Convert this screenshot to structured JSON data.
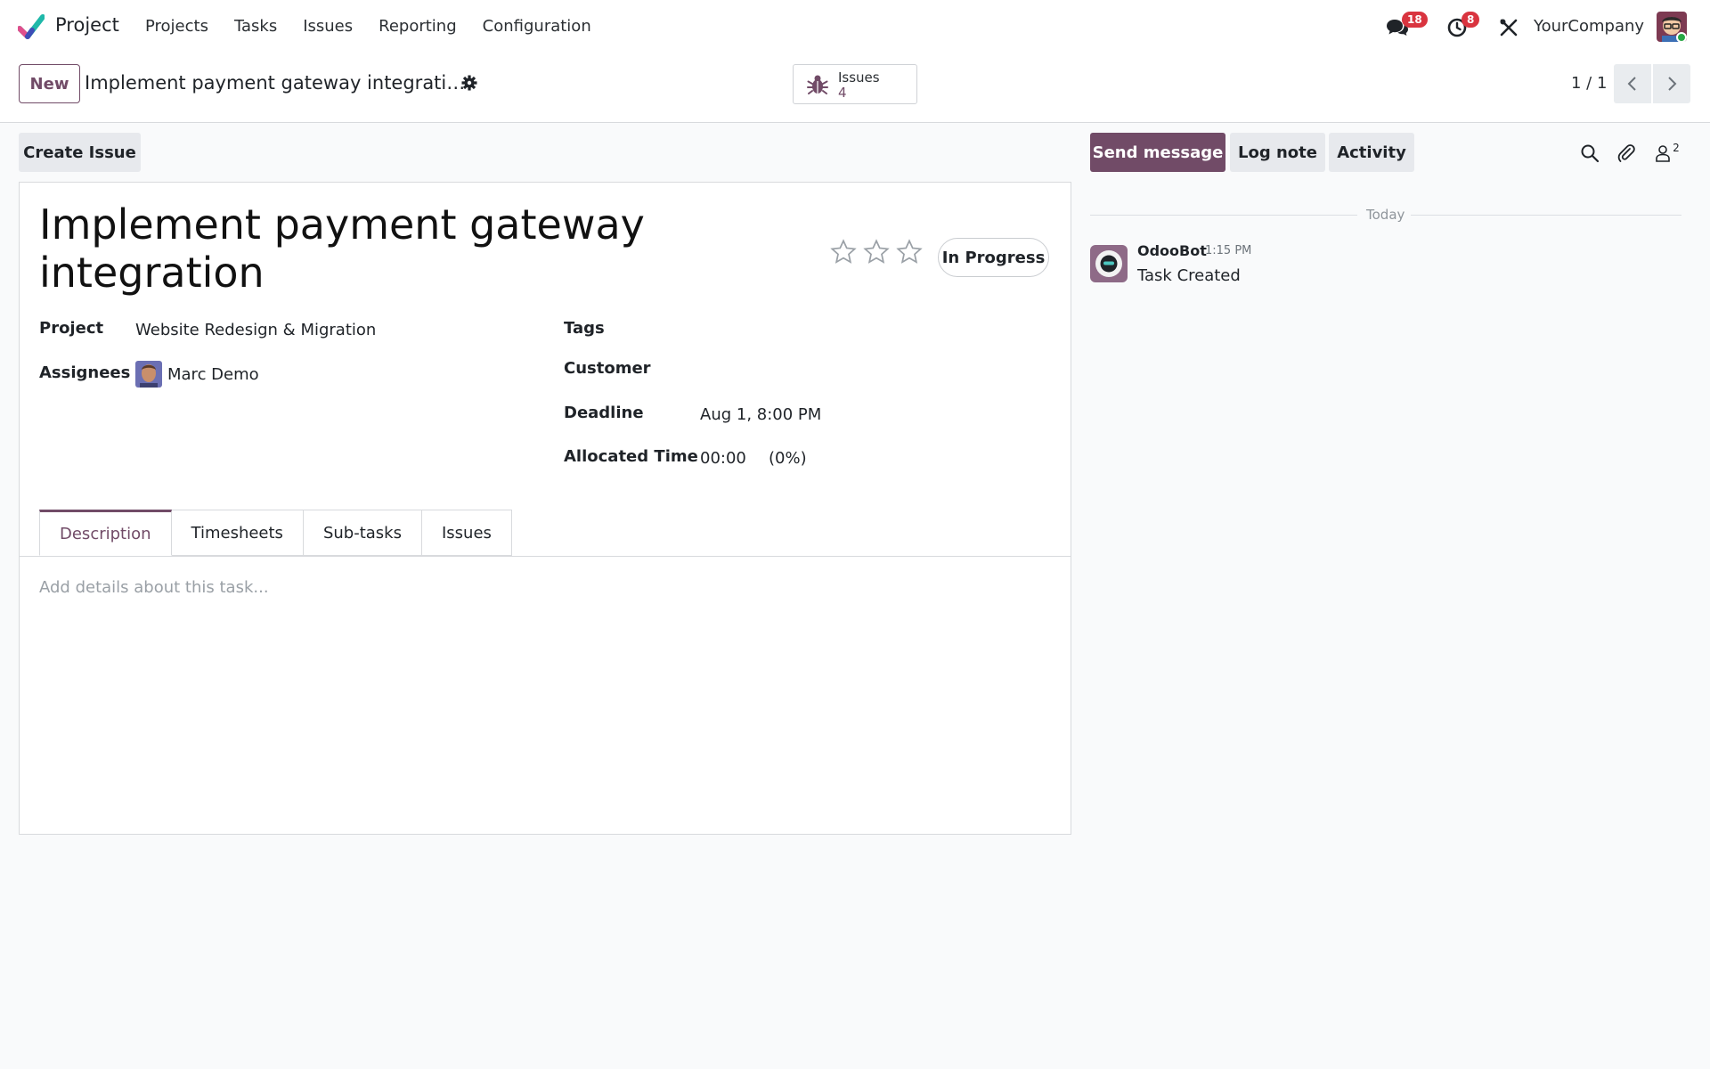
{
  "nav": {
    "app_name": "Project",
    "menu": [
      "Projects",
      "Tasks",
      "Issues",
      "Reporting",
      "Configuration"
    ],
    "messages_count": "18",
    "activities_count": "8",
    "company": "YourCompany"
  },
  "control": {
    "new_label": "New",
    "breadcrumb": "Implement payment gateway integrati…",
    "smart_button": {
      "label": "Issues",
      "value": "4"
    },
    "pager": "1 / 1"
  },
  "actions": {
    "create_issue": "Create Issue",
    "send_message": "Send message",
    "log_note": "Log note",
    "activity": "Activity",
    "followers_count": "2"
  },
  "task": {
    "name_line1": "Implement payment gateway",
    "name_line2": "integration",
    "priority_stars": 0,
    "priority_max": 3,
    "status": "In Progress",
    "fields": {
      "project_label": "Project",
      "project_value": "Website Redesign & Migration",
      "assignees_label": "Assignees",
      "assignee_value": "Marc Demo",
      "tags_label": "Tags",
      "customer_label": "Customer",
      "deadline_label": "Deadline",
      "deadline_value": "Aug 1, 8:00 PM",
      "allocated_label": "Allocated Time",
      "allocated_value": "00:00",
      "allocated_percent": "(0%)"
    },
    "tabs": [
      "Description",
      "Timesheets",
      "Sub-tasks",
      "Issues"
    ],
    "active_tab": "Description",
    "description_placeholder": "Add details about this task..."
  },
  "chatter": {
    "date_separator": "Today",
    "messages": [
      {
        "author": "OdooBot",
        "time": "1:15 PM",
        "body": "Task Created"
      }
    ]
  },
  "colors": {
    "brand": "#714b67",
    "badge": "#d9343f",
    "online": "#28a745"
  }
}
